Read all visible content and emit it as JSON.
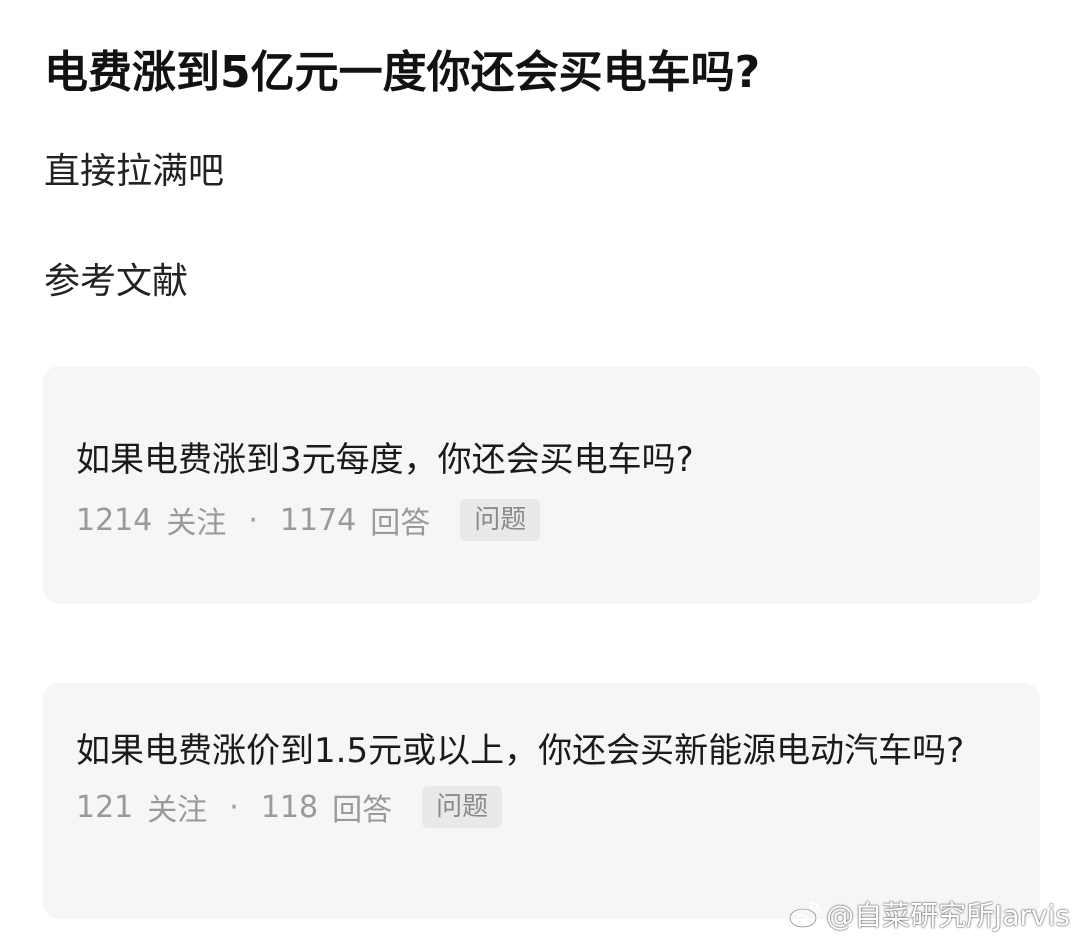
{
  "page": {
    "title": "电费涨到5亿元一度你还会买电车吗?",
    "answer_text": "直接拉满吧",
    "references_heading": "参考文献"
  },
  "cards": [
    {
      "title": "如果电费涨到3元每度，你还会买电车吗?",
      "followers": "1214",
      "followers_label": "关注",
      "separator": "·",
      "answers": "1174",
      "answers_label": "回答",
      "tag": "问题"
    },
    {
      "title": "如果电费涨价到1.5元或以上，你还会买新能源电动汽车吗?",
      "followers": "121",
      "followers_label": "关注",
      "separator": "·",
      "answers": "118",
      "answers_label": "回答",
      "tag": "问题"
    }
  ],
  "watermark": {
    "text": "@自菜研究所Jarvis",
    "icon": "weibo-icon"
  }
}
